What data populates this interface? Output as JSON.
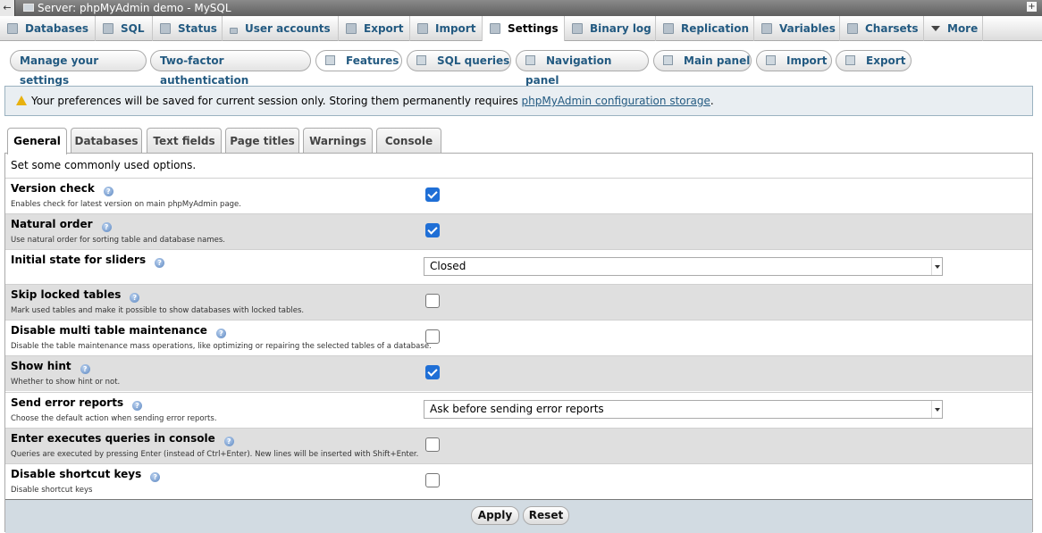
{
  "breadcrumb": {
    "text": "Server: phpMyAdmin demo - MySQL"
  },
  "topmenu": {
    "tabs": [
      {
        "label": "Databases",
        "icon": "database-icon"
      },
      {
        "label": "SQL",
        "icon": "sql-icon"
      },
      {
        "label": "Status",
        "icon": "status-icon"
      },
      {
        "label": "User accounts",
        "icon": "user-accounts-icon"
      },
      {
        "label": "Export",
        "icon": "export-icon"
      },
      {
        "label": "Import",
        "icon": "import-icon"
      },
      {
        "label": "Settings",
        "icon": "wrench-icon",
        "active": true
      },
      {
        "label": "Binary log",
        "icon": "binary-log-icon"
      },
      {
        "label": "Replication",
        "icon": "replication-icon"
      },
      {
        "label": "Variables",
        "icon": "variables-icon"
      },
      {
        "label": "Charsets",
        "icon": "charsets-icon"
      },
      {
        "label": "More",
        "icon": "chevron-down-icon"
      }
    ]
  },
  "submenu": {
    "items": [
      {
        "label": "Manage your settings"
      },
      {
        "label": "Two-factor authentication"
      },
      {
        "label": "Features",
        "icon": "wrench-icon",
        "active": true
      },
      {
        "label": "SQL queries",
        "icon": "sql-icon"
      },
      {
        "label": "Navigation panel",
        "icon": "navigation-icon"
      },
      {
        "label": "Main panel",
        "icon": "main-panel-icon"
      },
      {
        "label": "Import",
        "icon": "import-icon"
      },
      {
        "label": "Export",
        "icon": "export-icon"
      }
    ]
  },
  "notice": {
    "text": "Your preferences will be saved for current session only. Storing them permanently requires ",
    "link": "phpMyAdmin configuration storage",
    "suffix": "."
  },
  "form_tabs": [
    {
      "label": "General",
      "active": true
    },
    {
      "label": "Databases"
    },
    {
      "label": "Text fields"
    },
    {
      "label": "Page titles"
    },
    {
      "label": "Warnings"
    },
    {
      "label": "Console"
    }
  ],
  "panel": {
    "description": "Set some commonly used options.",
    "rows": [
      {
        "label": "Version check",
        "desc": "Enables check for latest version on main phpMyAdmin page.",
        "type": "checkbox",
        "checked": true
      },
      {
        "label": "Natural order",
        "desc": "Use natural order for sorting table and database names.",
        "type": "checkbox",
        "checked": true
      },
      {
        "label": "Initial state for sliders",
        "desc": "",
        "type": "select",
        "value": "Closed"
      },
      {
        "label": "Skip locked tables",
        "desc": "Mark used tables and make it possible to show databases with locked tables.",
        "type": "checkbox",
        "checked": false
      },
      {
        "label": "Disable multi table maintenance",
        "desc": "Disable the table maintenance mass operations, like optimizing or repairing the selected tables of a database.",
        "type": "checkbox",
        "checked": false
      },
      {
        "label": "Show hint",
        "desc": "Whether to show hint or not.",
        "type": "checkbox",
        "checked": true
      },
      {
        "label": "Send error reports",
        "desc": "Choose the default action when sending error reports.",
        "type": "select",
        "value": "Ask before sending error reports"
      },
      {
        "label": "Enter executes queries in console",
        "desc": "Queries are executed by pressing Enter (instead of Ctrl+Enter). New lines will be inserted with Shift+Enter.",
        "type": "checkbox",
        "checked": false
      },
      {
        "label": "Disable shortcut keys",
        "desc": "Disable shortcut keys",
        "type": "checkbox",
        "checked": false
      }
    ]
  },
  "footer": {
    "apply_label": "Apply",
    "reset_label": "Reset"
  },
  "colors": {
    "link": "#235a81",
    "checkbox_checked": "#1f6fd6",
    "alt_row": "#dfdfdf",
    "footer_bg": "#d2dbe2"
  }
}
